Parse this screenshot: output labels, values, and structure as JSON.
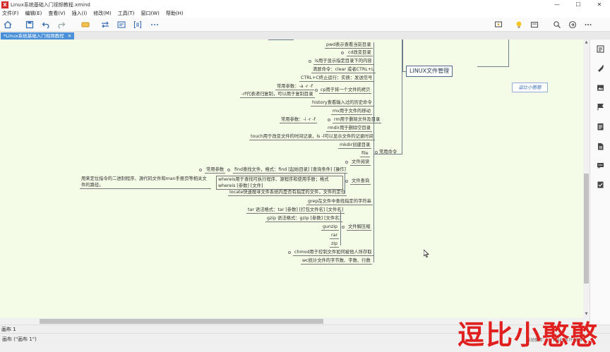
{
  "window": {
    "title": "Linux系统基础入门视频教程.xmind",
    "app_icon": "X",
    "controls": [
      "—",
      "☐",
      "✕"
    ]
  },
  "menu": [
    "文件(F)",
    "编辑(E)",
    "查看(V)",
    "插入(I)",
    "修改(M)",
    "工具(T)",
    "窗口(W)",
    "帮助(H)"
  ],
  "tab": {
    "label": "*Linux系统基础入门视频教程",
    "close": "✕"
  },
  "map": {
    "main_topic": "LINUX文件管理",
    "float_topic": "逗比小憨憨",
    "group_label": "常用命令",
    "nodes": [
      "pwd表示查看当前目录",
      "cd改变目录",
      "ls用于显示指定目录下的内容",
      "清屏命令：clear 或者CTRL+L",
      "CTRL+C终止运行：实质：发送信号",
      "常用参数：-a -r -f",
      "cp用于将一个文件的拷贝",
      "-rf代表递归复制，可以用于复制目录",
      "history查看输入过的历史命令",
      "mv用于文件的移动",
      "常用参数：-i -r -f",
      "rm用于删除文件及目录",
      "rmdir用于删除空目录",
      "touch用于改变文件的时间记录，ls -l可以显示文件的记录时间",
      "mkdir创建目录",
      "file",
      "文件阅读",
      "常用参数",
      "find查找文件，格式：find [起始目录] [查询条件] [操作]",
      "用来定位指令的二进制程序、源代码文件和man手册页等相关文件的路径。",
      "whereis用于查找可执行程序、源程序和使用手册；格式whereis [参数] [文件]",
      "文件查询",
      "locate快速搜寻文件系统内是否有指定的文件，文件的定位",
      "grep在文件中查找指定的字符串",
      "tar 语法格式：tar [参数] [打包文件名] [文件名]",
      "gzip 语法格式：gzip [参数] [文件名]",
      "gunzip",
      "文件解压缩",
      "rar",
      "zip",
      "chmod用于控制文件如何被他人所存取",
      "wc统计文件的字节数、字数、行数"
    ]
  },
  "sheet": {
    "tab": "画布 1"
  },
  "status": {
    "left": "画布 (\"画布 1\")",
    "right": "自动保存：…  WAFRB7FSQN"
  },
  "watermark": "逗比小憨憨",
  "colors": {
    "canvas": "#f4fbe6",
    "accent": "#4a90d9",
    "watermark": "#e0201e"
  }
}
